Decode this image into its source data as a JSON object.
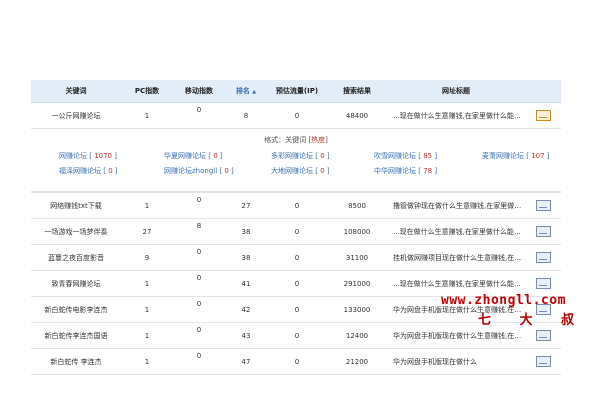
{
  "table": {
    "headers": [
      "关键词",
      "PC指数",
      "移动指数",
      "排名",
      "预估流量(IP)",
      "搜索结果",
      "网址标题"
    ],
    "sort_arrow": "▲",
    "rows": [
      {
        "keyword": "一公斤网赚论坛",
        "pc": "1",
        "mobile": "0",
        "rank": "8",
        "traffic": "0",
        "results": "48400",
        "title": "...现在做什么生意赚钱,在家里做什么能赚钱...",
        "icon": "orange"
      },
      {
        "keyword": "网络赚钱txt下载",
        "pc": "1",
        "mobile": "0",
        "rank": "27",
        "traffic": "0",
        "results": "8500",
        "title": "撸管做钟现在做什么生意赚钱,在家里做什么能赚...",
        "icon": "blue"
      },
      {
        "keyword": "一场游戏一场梦伴奏",
        "pc": "27",
        "mobile": "8",
        "rank": "38",
        "traffic": "0",
        "results": "108000",
        "title": "...现在做什么生意赚钱,在家里做什么能赚钱...",
        "icon": "blue"
      },
      {
        "keyword": "蓝蔓之夜百度影音",
        "pc": "9",
        "mobile": "0",
        "rank": "38",
        "traffic": "0",
        "results": "31100",
        "title": "挂机做网赚项目现在做什么生意赚钱,在家里做...",
        "icon": "blue"
      },
      {
        "keyword": "致青春网赚论坛",
        "pc": "1",
        "mobile": "0",
        "rank": "41",
        "traffic": "0",
        "results": "291000",
        "title": "...现在做什么生意赚钱,在家里做什么能赚钱...",
        "icon": "blue"
      },
      {
        "keyword": "新白蛇传电影李连杰",
        "pc": "1",
        "mobile": "0",
        "rank": "42",
        "traffic": "0",
        "results": "133000",
        "title": "华为网盘手机版现在做什么生意赚钱,在家里做...",
        "icon": "blue"
      },
      {
        "keyword": "新白蛇传李连杰国语",
        "pc": "1",
        "mobile": "0",
        "rank": "43",
        "traffic": "0",
        "results": "12400",
        "title": "华为网盘手机版现在做什么生意赚钱,在家里做...",
        "icon": "blue"
      },
      {
        "keyword": "新白蛇传 李连杰",
        "pc": "1",
        "mobile": "0",
        "rank": "47",
        "traffic": "0",
        "results": "21200",
        "title": "华为网盘手机版现在做什么",
        "icon": "blue"
      }
    ]
  },
  "related": {
    "format_prefix": "格式：关键词 [",
    "format_highlight": "热度",
    "format_suffix": "]",
    "keywords": [
      {
        "name": "网赚论坛",
        "count": "1070"
      },
      {
        "name": "华夏网赚论坛",
        "count": "0"
      },
      {
        "name": "多彩网赚论坛",
        "count": "0"
      },
      {
        "name": "吹雪网赚论坛",
        "count": "85"
      },
      {
        "name": "麦萧网赚论坛",
        "count": "107"
      },
      {
        "name": "福泽网赚论坛",
        "count": "0"
      },
      {
        "name": "网赚论坛zhongll",
        "count": "0"
      },
      {
        "name": "大地网赚论坛",
        "count": "0"
      },
      {
        "name": "中华网赚论坛",
        "count": "78"
      }
    ]
  },
  "watermark": {
    "url": "www.zhongll.com",
    "name": "七 大 叔"
  }
}
